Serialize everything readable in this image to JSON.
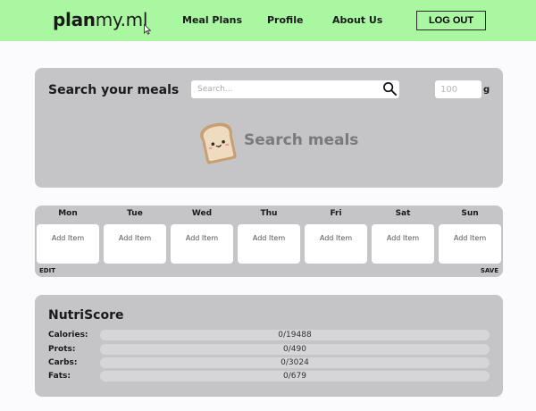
{
  "nav": {
    "logo_bold": "plan",
    "logo_regular": "my.ml",
    "links": [
      "Meal Plans",
      "Profile",
      "About Us"
    ],
    "logout_label": "LOG OUT",
    "accent_color": "#a9f7a1"
  },
  "search": {
    "title": "Search your meals",
    "placeholder": "Search...",
    "value": "",
    "grams_placeholder": "100",
    "grams_unit": "g",
    "empty_state_text": "Search meals",
    "search_icon": "magnifier-icon",
    "empty_state_icon": "toast-icon"
  },
  "week": {
    "days": [
      {
        "name": "Mon",
        "add_label": "Add Item"
      },
      {
        "name": "Tue",
        "add_label": "Add Item"
      },
      {
        "name": "Wed",
        "add_label": "Add Item"
      },
      {
        "name": "Thu",
        "add_label": "Add Item"
      },
      {
        "name": "Fri",
        "add_label": "Add Item"
      },
      {
        "name": "Sat",
        "add_label": "Add Item"
      },
      {
        "name": "Sun",
        "add_label": "Add Item"
      }
    ],
    "edit_label": "EDIT",
    "save_label": "SAVE"
  },
  "nutriscore": {
    "title": "NutriScore",
    "rows": [
      {
        "label": "Calories:",
        "value": "0/19488",
        "current": 0,
        "target": 19488
      },
      {
        "label": "Prots:",
        "value": "0/490",
        "current": 0,
        "target": 490
      },
      {
        "label": "Carbs:",
        "value": "0/3024",
        "current": 0,
        "target": 3024
      },
      {
        "label": "Fats:",
        "value": "0/679",
        "current": 0,
        "target": 679
      }
    ]
  }
}
